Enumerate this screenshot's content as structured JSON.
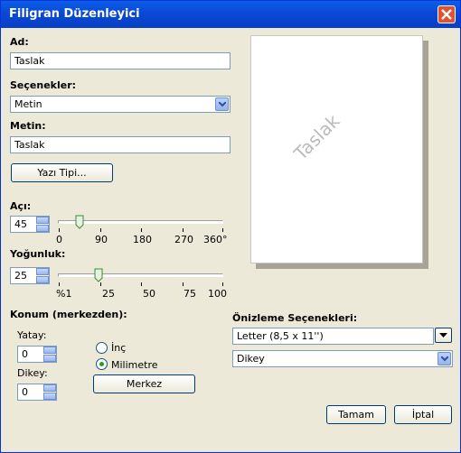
{
  "window": {
    "title": "Filigran Düzenleyici"
  },
  "name": {
    "label": "Ad:",
    "value": "Taslak"
  },
  "options": {
    "label": "Seçenekler:",
    "value": "Metin"
  },
  "text": {
    "label": "Metin:",
    "value": "Taslak"
  },
  "font_button": "Yazı Tipi...",
  "angle": {
    "label": "Açı:",
    "value": "45",
    "ticks": [
      "0",
      "90",
      "180",
      "270",
      "360°"
    ],
    "level_degrees": 45
  },
  "density": {
    "label": "Yoğunluk:",
    "value": "25",
    "ticks": [
      "%1",
      "25",
      "50",
      "75",
      "100"
    ],
    "level_percent": 25
  },
  "position": {
    "label": "Konum (merkezden):",
    "horizontal_label": "Yatay:",
    "horizontal_value": "0",
    "vertical_label": "Dikey:",
    "vertical_value": "0",
    "unit_inch": "İnç",
    "unit_mm": "Milimetre",
    "selected_unit": "Milimetre",
    "center_button": "Merkez"
  },
  "preview": {
    "watermark": "Taslak",
    "options_label": "Önizleme Seçenekleri:",
    "paper": "Letter (8,5 x 11'')",
    "orientation": "Dikey"
  },
  "ok_button": "Tamam",
  "cancel_button": "İptal",
  "colors": {
    "title_bar": "#0a48d5",
    "window_bg": "#ece9d8",
    "watermark": "#bbbbbb",
    "close": "#e2502f"
  }
}
